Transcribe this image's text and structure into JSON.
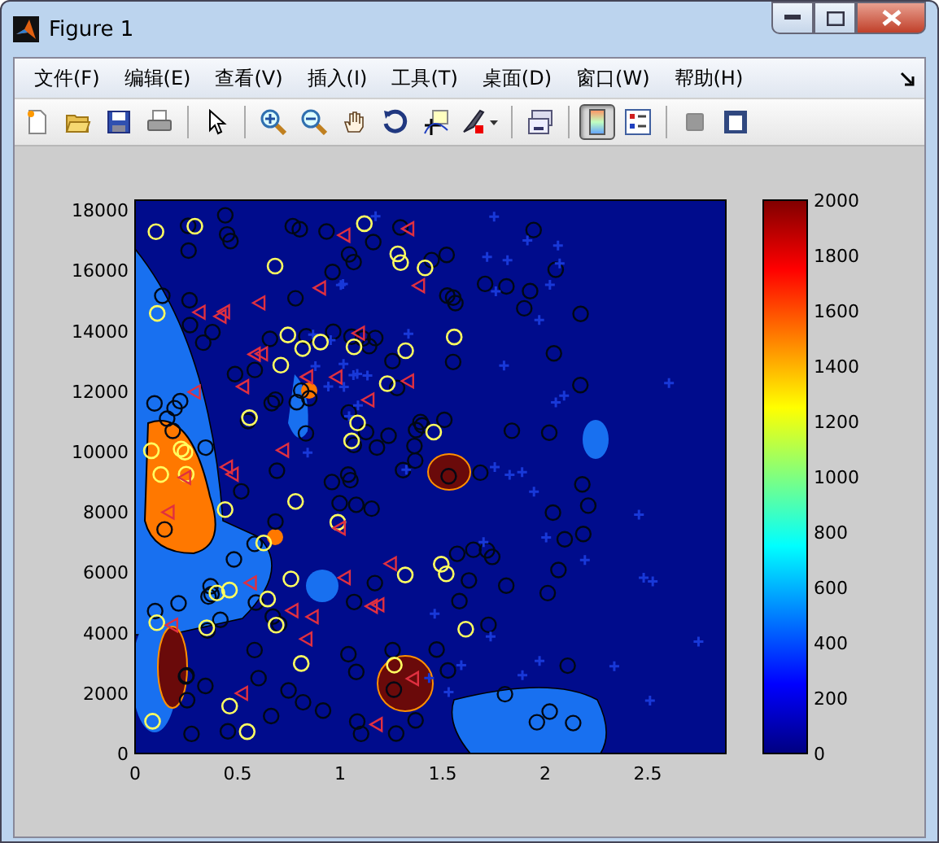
{
  "window": {
    "title": "Figure 1"
  },
  "menu": [
    {
      "label": "文件(F)"
    },
    {
      "label": "编辑(E)"
    },
    {
      "label": "查看(V)"
    },
    {
      "label": "插入(I)"
    },
    {
      "label": "工具(T)"
    },
    {
      "label": "桌面(D)"
    },
    {
      "label": "窗口(W)"
    },
    {
      "label": "帮助(H)"
    }
  ],
  "toolbar": [
    {
      "kind": "new",
      "selected": false
    },
    {
      "kind": "open",
      "selected": false
    },
    {
      "kind": "save",
      "selected": false
    },
    {
      "kind": "print",
      "selected": false
    },
    {
      "kind": "separator"
    },
    {
      "kind": "pointer",
      "selected": false
    },
    {
      "kind": "separator"
    },
    {
      "kind": "zoom-in",
      "selected": false
    },
    {
      "kind": "zoom-out",
      "selected": false
    },
    {
      "kind": "pan",
      "selected": false
    },
    {
      "kind": "rotate",
      "selected": false
    },
    {
      "kind": "data-cursor",
      "selected": false
    },
    {
      "kind": "brush",
      "selected": false
    },
    {
      "kind": "separator"
    },
    {
      "kind": "link",
      "selected": false
    },
    {
      "kind": "separator"
    },
    {
      "kind": "colorbar",
      "selected": true
    },
    {
      "kind": "legend",
      "selected": false
    },
    {
      "kind": "separator"
    },
    {
      "kind": "hide-tools",
      "selected": false
    },
    {
      "kind": "show-tools",
      "selected": false
    }
  ],
  "plot": {
    "yticks": [
      "18000",
      "16000",
      "14000",
      "12000",
      "10000",
      "8000",
      "6000",
      "4000",
      "2000",
      "0"
    ],
    "xticks": [
      "0",
      "0.5",
      "1",
      "1.5",
      "2",
      "2.5"
    ],
    "colorbar_ticks": [
      "2000",
      "1800",
      "1600",
      "1400",
      "1200",
      "1000",
      "800",
      "600",
      "400",
      "200",
      "0"
    ]
  }
}
